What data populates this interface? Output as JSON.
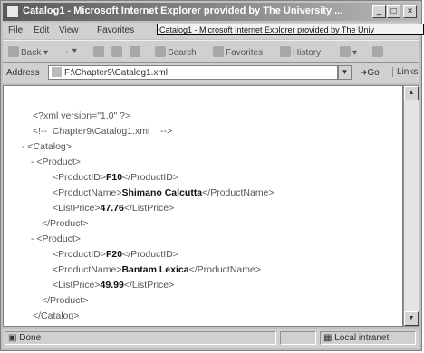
{
  "window": {
    "title": "Catalog1 - Microsoft Internet Explorer provided by The University ...",
    "controls": {
      "minimize": "_",
      "maximize": "□",
      "close": "×"
    }
  },
  "tooltip": "Catalog1 - Microsoft Internet Explorer provided by The Univ",
  "menu": [
    "File",
    "Edit",
    "View",
    "Favorites"
  ],
  "toolbar": {
    "back": "Back",
    "search": "Search",
    "favorites": "Favorites",
    "history": "History"
  },
  "address": {
    "label": "Address",
    "value": "F:\\Chapter9\\Catalog1.xml",
    "go": "Go",
    "links": "Links"
  },
  "xml": {
    "decl": "<?xml version=\"1.0\" ?>",
    "comment_open": "<!--",
    "comment_text": "Chapter9\\Catalog1.xml",
    "comment_close": "-->",
    "catalog_open": "<Catalog>",
    "catalog_close": "</Catalog>",
    "toggle": "-",
    "product_open": "<Product>",
    "product_close": "</Product>",
    "products": [
      {
        "id_open": "<ProductID>",
        "id": "F10",
        "id_close": "</ProductID>",
        "name_open": "<ProductName>",
        "name": "Shimano Calcutta",
        "name_close": "</ProductName>",
        "price_open": "<ListPrice>",
        "price": "47.76",
        "price_close": "</ListPrice>"
      },
      {
        "id_open": "<ProductID>",
        "id": "F20",
        "id_close": "</ProductID>",
        "name_open": "<ProductName>",
        "name": "Bantam Lexica",
        "name_close": "</ProductName>",
        "price_open": "<ListPrice>",
        "price": "49.99",
        "price_close": "</ListPrice>"
      }
    ]
  },
  "status": {
    "left": "Done",
    "right": "Local intranet"
  }
}
